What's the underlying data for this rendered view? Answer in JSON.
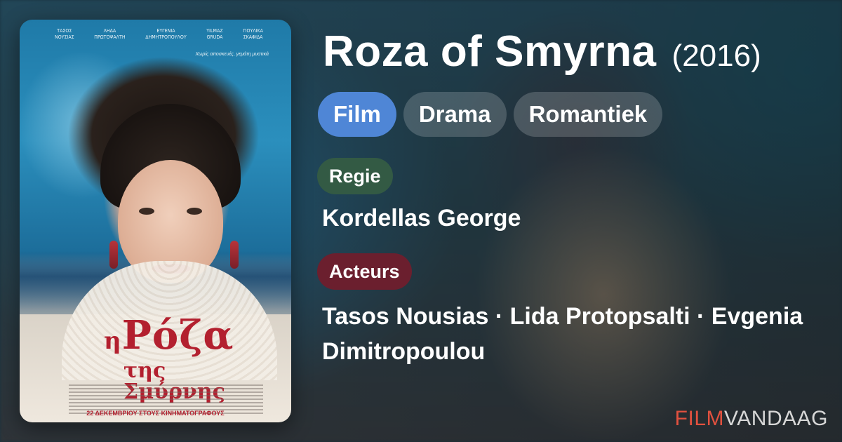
{
  "poster": {
    "cast_names": [
      "ΤΑΣΟΣ\nΝΟΥΣΙΑΣ",
      "ΛΗΔΑ\nΠΡΩΤΟΨΑΛΤΗ",
      "ΕΥΓΕΝΙΑ\nΔΗΜΗΤΡΟΠΟΥΛΟΥ",
      "YILMAZ\nGRUDA",
      "ΓΙΟΥΛΙΚΑ\nΣΚΑΦΙΔΑ"
    ],
    "tagline": "Χωρίς αποσκευές, γεμάτη μυστικά",
    "title_big": "Ρόζα",
    "title_prefix": "η",
    "title_small": "της Σμύρνης",
    "release_line": "22 ΔΕΚΕΜΒΡΙΟΥ ΣΤΟΥΣ ΚΙΝΗΜΑΤΟΓΡΑΦΟΥΣ"
  },
  "movie": {
    "title": "Roza of Smyrna",
    "year": "(2016)"
  },
  "genres": [
    "Film",
    "Drama",
    "Romantiek"
  ],
  "labels": {
    "director": "Regie",
    "actors": "Acteurs"
  },
  "director": "Kordellas George",
  "actors": "Tasos Nousias · Lida Protopsalti · Evgenia Dimitropoulou",
  "brand": {
    "part1": "FILM",
    "part2": "VANDAAG"
  },
  "colors": {
    "primary_genre": "#4f86d6",
    "regie_label": "#335a44",
    "acteurs_label": "#6b1f2e",
    "brand_accent": "#e2513f"
  }
}
